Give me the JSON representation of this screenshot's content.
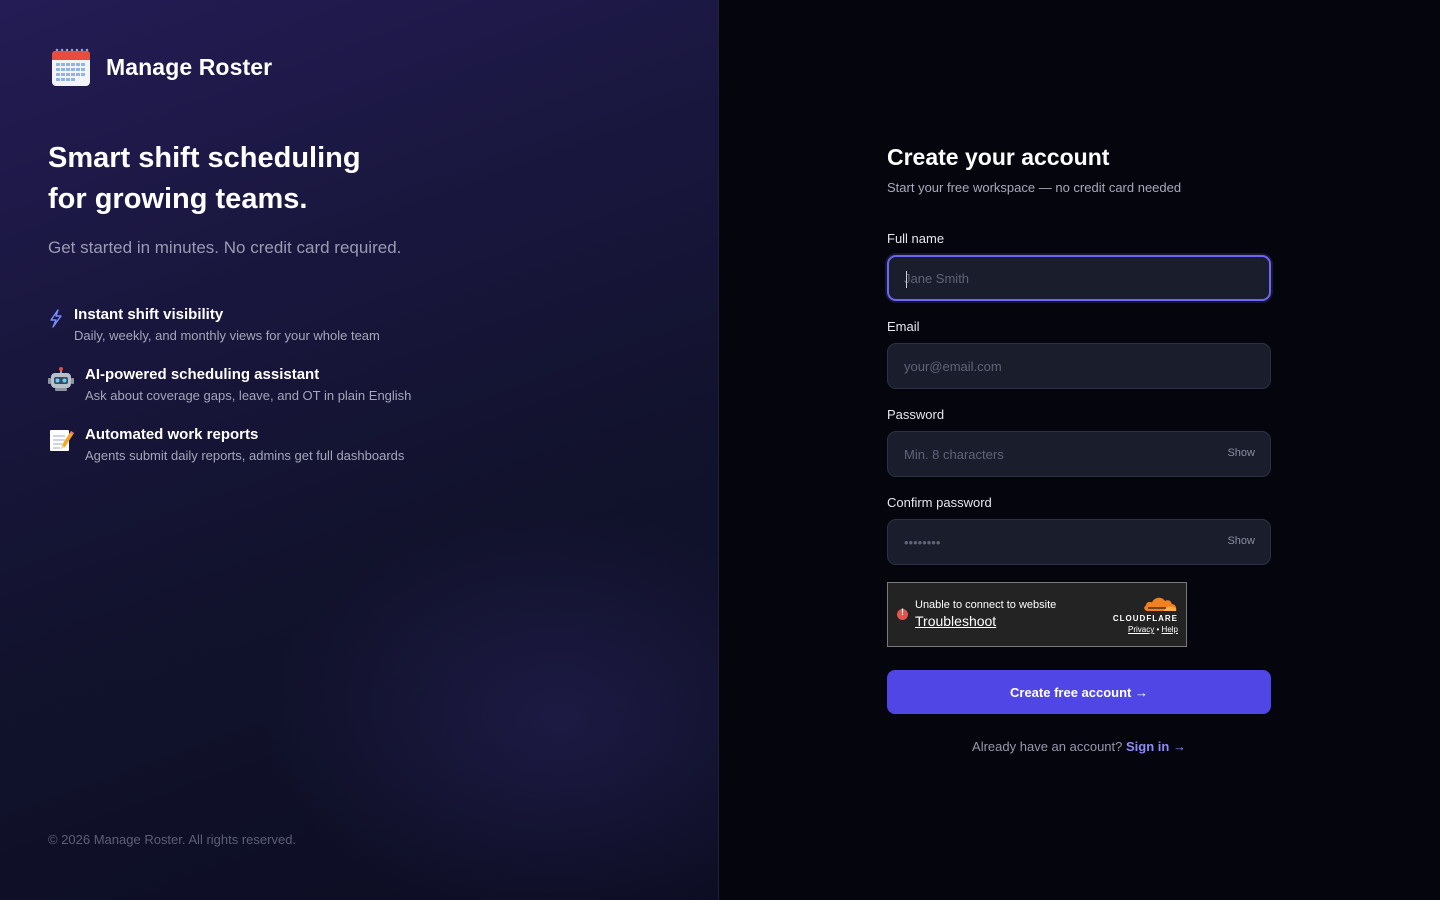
{
  "brand": {
    "name": "Manage Roster",
    "icon": "calendar-icon"
  },
  "hero": {
    "headline_line1": "Smart shift scheduling",
    "headline_line2": "for growing teams.",
    "subhead": "Get started in minutes. No credit card required."
  },
  "features": [
    {
      "icon": "lightning-icon",
      "title": "Instant shift visibility",
      "desc": "Daily, weekly, and monthly views for your whole team"
    },
    {
      "icon": "robot-icon",
      "title": "AI-powered scheduling assistant",
      "desc": "Ask about coverage gaps, leave, and OT in plain English"
    },
    {
      "icon": "memo-icon",
      "title": "Automated work reports",
      "desc": "Agents submit daily reports, admins get full dashboards"
    }
  ],
  "footer": "© 2026 Manage Roster. All rights reserved.",
  "form": {
    "title": "Create your account",
    "subtitle": "Start your free workspace — no credit card needed",
    "full_name": {
      "label": "Full name",
      "placeholder": "Jane Smith",
      "value": ""
    },
    "email": {
      "label": "Email",
      "placeholder": "your@email.com",
      "value": ""
    },
    "password": {
      "label": "Password",
      "placeholder": "Min. 8 characters",
      "value": "",
      "toggle": "Show"
    },
    "confirm_password": {
      "label": "Confirm password",
      "placeholder": "••••••••",
      "toggle": "Show"
    },
    "submit_label": "Create free account →",
    "signin_prompt": "Already have an account?",
    "signin_link": "Sign in →"
  },
  "captcha": {
    "message": "Unable to connect to website",
    "link": "Troubleshoot",
    "brand": "CLOUDFLARE",
    "privacy": "Privacy",
    "separator": "•",
    "help": "Help"
  },
  "colors": {
    "accent": "#4f46e5",
    "focus_ring": "#6c66f0",
    "link": "#8f8af7",
    "error": "#e3554c",
    "cloudflare_orange": "#f38020"
  }
}
